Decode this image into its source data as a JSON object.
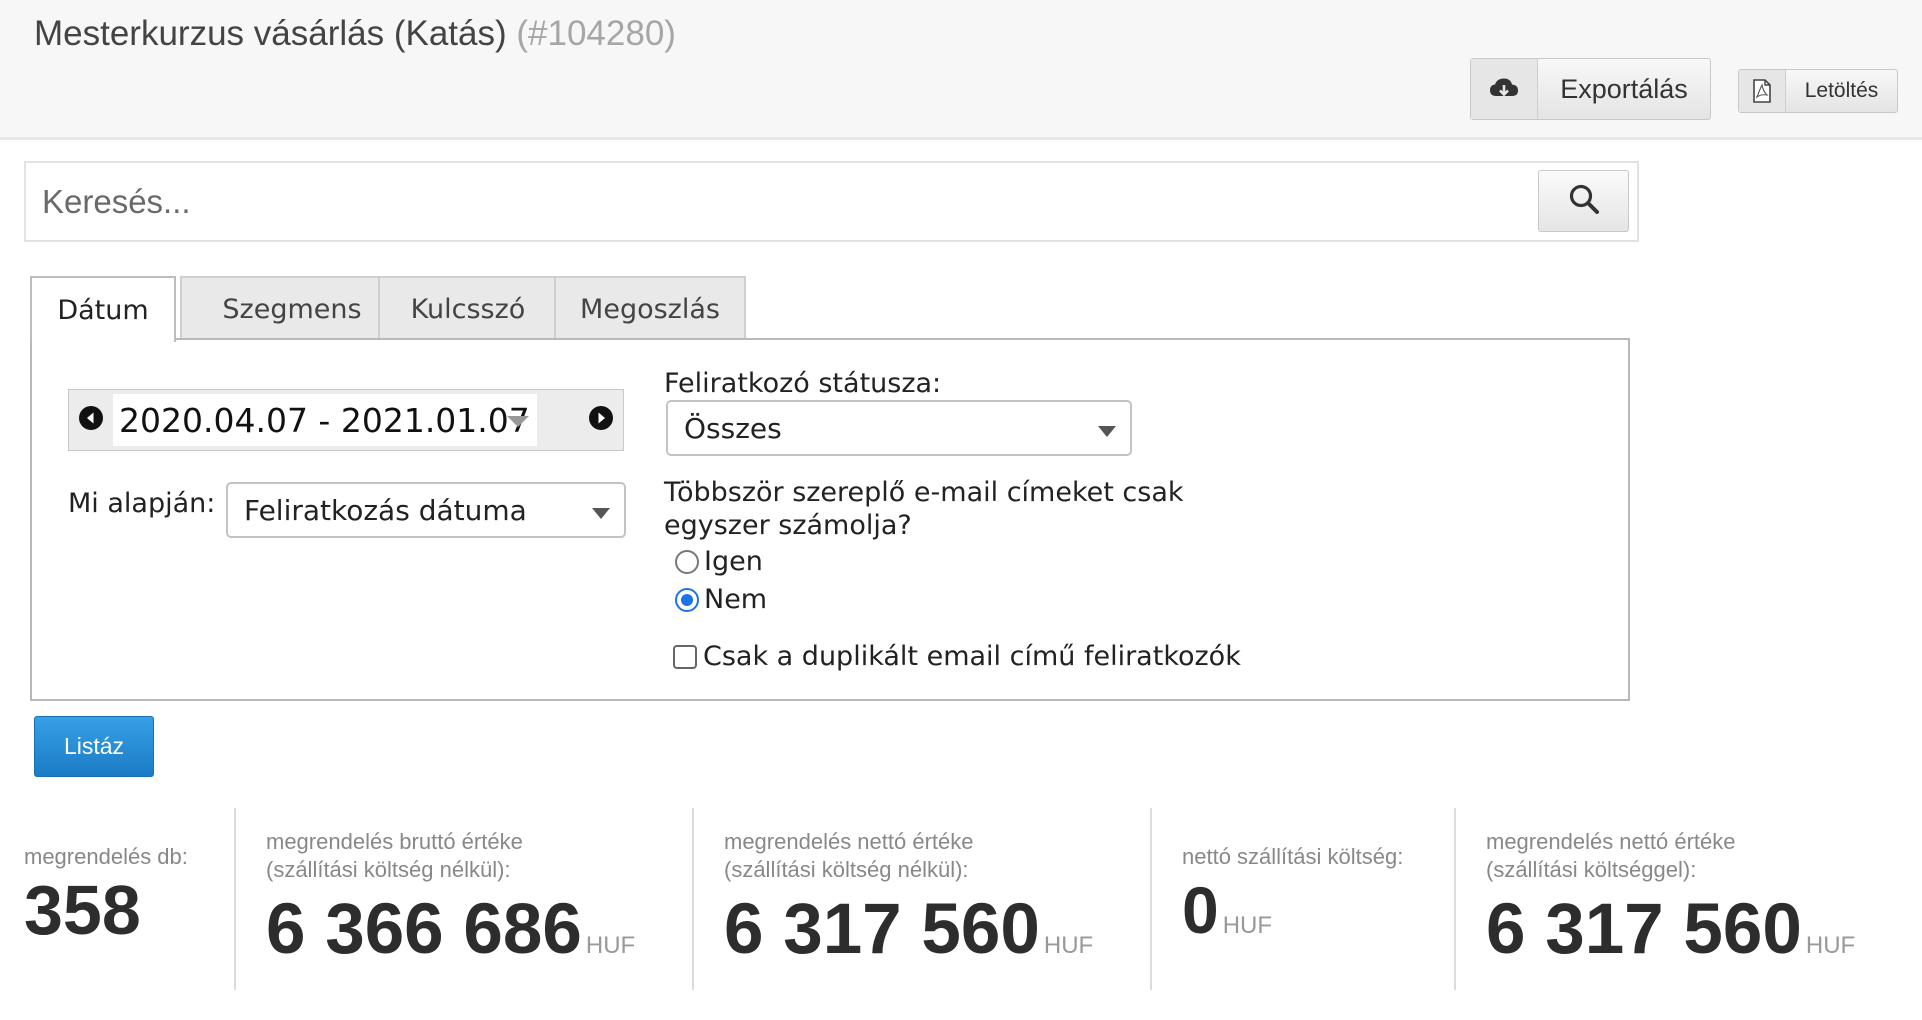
{
  "header": {
    "title": "Mesterkurzus vásárlás (Katás)",
    "id": "(#104280)",
    "export_label": "Exportálás",
    "download_label": "Letöltés"
  },
  "search": {
    "placeholder": "Keresés..."
  },
  "tabs": [
    {
      "label": "Dátum",
      "active": true
    },
    {
      "label": "Szegmens",
      "active": false
    },
    {
      "label": "Kulcsszó",
      "active": false
    },
    {
      "label": "Megoszlás",
      "active": false
    }
  ],
  "date_filter": {
    "range": "2020.04.07 - 2021.01.07",
    "basis_label": "Mi alapján:",
    "basis_value": "Feliratkozás dátuma"
  },
  "status_filter": {
    "label": "Feliratkozó státusza:",
    "value": "Összes"
  },
  "dedupe": {
    "question_line1": "Többször szereplő e-mail címeket csak",
    "question_line2": "egyszer számolja?",
    "options": [
      {
        "label": "Igen",
        "selected": false
      },
      {
        "label": "Nem",
        "selected": true
      }
    ],
    "duplicates_only_label": "Csak a duplikált email című feliratkozók",
    "duplicates_only_checked": false
  },
  "list_button": "Listáz",
  "stats": [
    {
      "caption1": "megrendelés db:",
      "caption2": "",
      "value": "358",
      "unit": ""
    },
    {
      "caption1": "megrendelés bruttó értéke",
      "caption2": "(szállítási költség nélkül):",
      "value": "6 366 686",
      "unit": "HUF"
    },
    {
      "caption1": "megrendelés nettó értéke",
      "caption2": "(szállítási költség nélkül):",
      "value": "6 317 560",
      "unit": "HUF"
    },
    {
      "caption1": "nettó szállítási költség:",
      "caption2": "",
      "value": "0",
      "unit": "HUF"
    },
    {
      "caption1": "megrendelés nettó értéke",
      "caption2": "(szállítási költséggel):",
      "value": "6 317 560",
      "unit": "HUF"
    }
  ],
  "colors": {
    "primary_button": "#1b7cc6",
    "radio_accent": "#1a73e8"
  },
  "icons": {
    "export": "cloud-download-icon",
    "download": "pdf-file-icon",
    "search": "search-icon",
    "prev": "arrow-left-circle-icon",
    "next": "arrow-right-circle-icon"
  }
}
